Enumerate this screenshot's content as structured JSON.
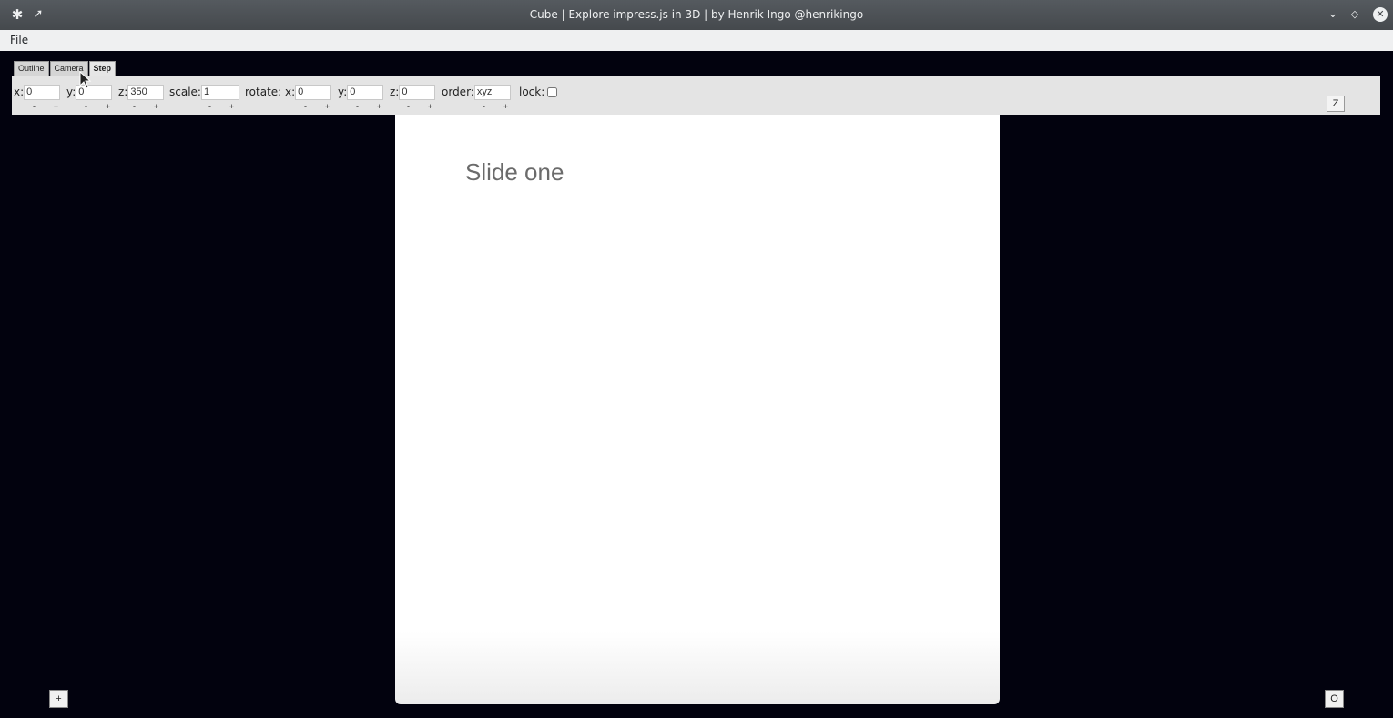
{
  "window": {
    "title": "Cube | Explore impress.js in 3D | by Henrik Ingo @henrikingo"
  },
  "titlebar_icons": {
    "left": [
      "app-icon",
      "pin-icon"
    ],
    "right": [
      "minimize-icon",
      "maximize-icon",
      "close-icon"
    ]
  },
  "menu": {
    "file": "File"
  },
  "tabs": [
    {
      "label": "Outline",
      "active": false
    },
    {
      "label": "Camera",
      "active": false
    },
    {
      "label": "Step",
      "active": true
    }
  ],
  "toolbar": {
    "x": {
      "label": "x:",
      "value": "0"
    },
    "y": {
      "label": "y:",
      "value": "0"
    },
    "z": {
      "label": "z:",
      "value": "350"
    },
    "scale": {
      "label": "scale:",
      "value": "1"
    },
    "rotate_x": {
      "label": "rotate: x:",
      "value": "0"
    },
    "rotate_y": {
      "label": "y:",
      "value": "0"
    },
    "rotate_z": {
      "label": "z:",
      "value": "0"
    },
    "order": {
      "label": "order:",
      "value": "xyz"
    },
    "lock": {
      "label": "lock:",
      "checked": false
    },
    "minus": "-",
    "plus": "+"
  },
  "z_button": "Z",
  "slide": {
    "title": "Slide one"
  },
  "bottom": {
    "add_label": "+",
    "overview_label": "O"
  }
}
